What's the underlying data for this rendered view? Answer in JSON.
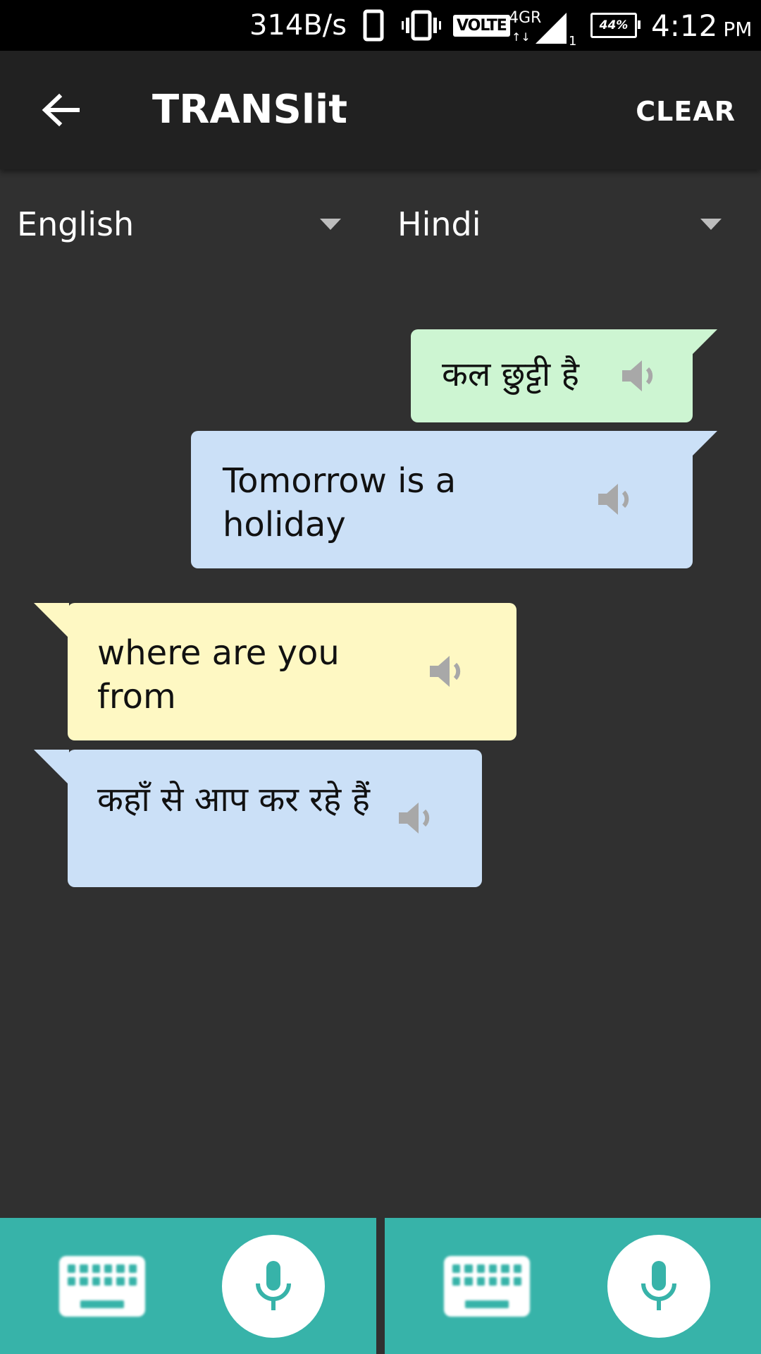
{
  "status_bar": {
    "net_speed": "314B/s",
    "volte": "VOLTE",
    "network": "4GR",
    "sim_index": "1",
    "battery": "44%",
    "time": "4:12",
    "ampm": "PM"
  },
  "app_bar": {
    "title": "TRANSlit",
    "clear_label": "CLEAR",
    "back_icon": "arrow-left-icon"
  },
  "languages": {
    "source": "English",
    "target": "Hindi"
  },
  "messages": [
    {
      "text": "कल छुट्टी है",
      "side": "right",
      "color": "#cdf5d2"
    },
    {
      "text": "Tomorrow is a holiday",
      "side": "right",
      "color": "#cbe0f7"
    },
    {
      "text": "where are you from",
      "side": "left",
      "color": "#fef8c3"
    },
    {
      "text": "कहाँ से आप कर रहे हैं",
      "side": "left",
      "color": "#cbe0f7"
    }
  ],
  "colors": {
    "accent": "#37b3a9",
    "background": "#303030",
    "app_bar": "#212121"
  },
  "bottom_bar": {
    "left": {
      "keyboard_icon": "keyboard-icon",
      "mic_icon": "mic-icon"
    },
    "right": {
      "keyboard_icon": "keyboard-icon",
      "mic_icon": "mic-icon"
    }
  }
}
